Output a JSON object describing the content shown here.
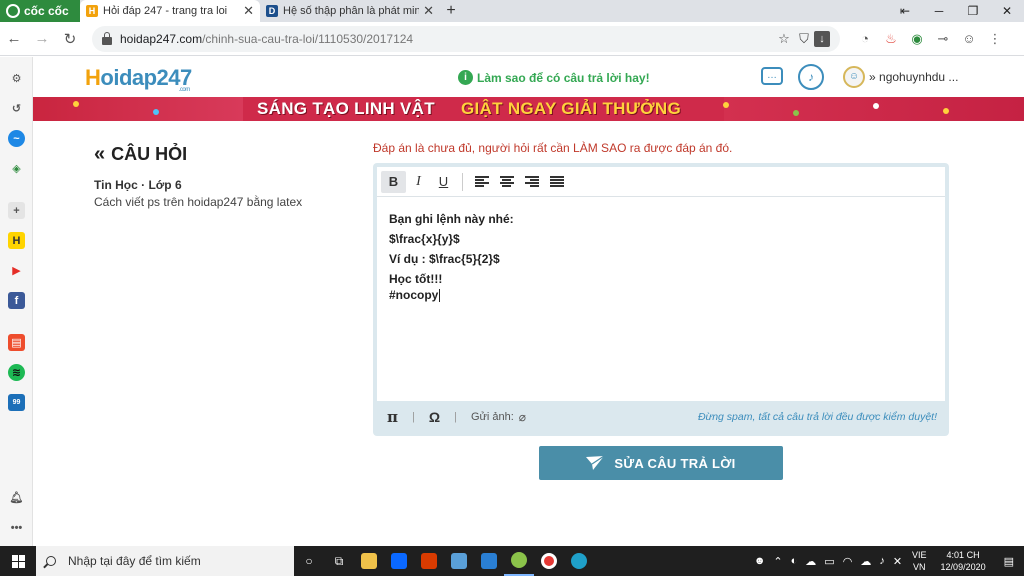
{
  "browser": {
    "brand": "cốc cốc",
    "tabs": [
      {
        "title": "Hỏi đáp 247 - trang tra loi",
        "favicon": "H"
      },
      {
        "title": "Hệ số thập phân là phát minh",
        "favicon": "D"
      }
    ],
    "url_host": "hoidap247.com",
    "url_path": "/chinh-sua-cau-tra-loi/1110530/2017124"
  },
  "header": {
    "logo": "oidap247",
    "logo_initial": "H",
    "logo_sub": ".com",
    "hint": "Làm sao để có câu trả lời hay!",
    "username": "ngohuynhdu ..."
  },
  "banner": {
    "part1": "SÁNG TẠO LINH VẬT",
    "part2": "GIẬT NGAY GIẢI THƯỞNG"
  },
  "question": {
    "heading": "CÂU HỎI",
    "meta": "Tin Học · Lớp 6",
    "text": "Cách viết ps trên hoidap247 bằng latex"
  },
  "editor": {
    "warning": "Đáp án là chưa đủ, người hỏi rất cần LÀM SAO ra được đáp án đó.",
    "toolbar": {
      "bold": "B",
      "italic": "I",
      "underline": "U"
    },
    "lines": [
      "Bạn ghi lệnh này nhé:",
      "$\\frac{x}{y}$",
      "Ví dụ : $\\frac{5}{2}$",
      "Học tốt!!!",
      "#nocopy"
    ],
    "footer": {
      "pi": "π",
      "omega": "Ω",
      "attach_label": "Gửi ảnh:",
      "spam_notice": "Đừng spam, tất cả câu trả lời đều được kiểm duyệt!"
    }
  },
  "submit_label": "SỬA CÂU TRẢ LỜI",
  "taskbar": {
    "search_placeholder": "Nhập tại đây để tìm kiếm",
    "lang_top": "VIE",
    "lang_bottom": "VN",
    "time": "4:01 CH",
    "date": "12/09/2020"
  },
  "colors": {
    "accent": "#3c8dbc",
    "banner": "#cf2a4a",
    "submit": "#4a8ea8",
    "hint": "#34a853",
    "warning": "#c0392b"
  }
}
